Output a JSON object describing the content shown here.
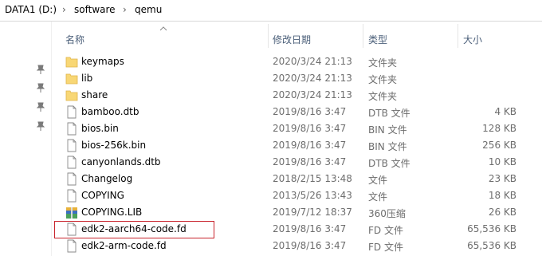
{
  "breadcrumb": [
    "DATA1 (D:)",
    "software",
    "qemu"
  ],
  "breadcrumb_sep": "›",
  "columns": {
    "name": "名称",
    "date": "修改日期",
    "type": "类型",
    "size": "大小"
  },
  "files": [
    {
      "name": "keymaps",
      "date": "2020/3/24 21:13",
      "type": "文件夹",
      "size": "",
      "icon": "folder-icon"
    },
    {
      "name": "lib",
      "date": "2020/3/24 21:13",
      "type": "文件夹",
      "size": "",
      "icon": "folder-icon"
    },
    {
      "name": "share",
      "date": "2020/3/24 21:13",
      "type": "文件夹",
      "size": "",
      "icon": "folder-icon"
    },
    {
      "name": "bamboo.dtb",
      "date": "2019/8/16 3:47",
      "type": "DTB 文件",
      "size": "4 KB",
      "icon": "file-icon"
    },
    {
      "name": "bios.bin",
      "date": "2019/8/16 3:47",
      "type": "BIN 文件",
      "size": "128 KB",
      "icon": "file-icon"
    },
    {
      "name": "bios-256k.bin",
      "date": "2019/8/16 3:47",
      "type": "BIN 文件",
      "size": "256 KB",
      "icon": "file-icon"
    },
    {
      "name": "canyonlands.dtb",
      "date": "2019/8/16 3:47",
      "type": "DTB 文件",
      "size": "10 KB",
      "icon": "file-icon"
    },
    {
      "name": "Changelog",
      "date": "2018/2/15 13:48",
      "type": "文件",
      "size": "23 KB",
      "icon": "file-icon"
    },
    {
      "name": "COPYING",
      "date": "2013/5/26 13:43",
      "type": "文件",
      "size": "18 KB",
      "icon": "file-icon"
    },
    {
      "name": "COPYING.LIB",
      "date": "2019/7/12 18:37",
      "type": "360压缩",
      "size": "26 KB",
      "icon": "archive-icon"
    },
    {
      "name": "edk2-aarch64-code.fd",
      "date": "2019/8/16 3:47",
      "type": "FD 文件",
      "size": "65,536 KB",
      "icon": "file-icon"
    },
    {
      "name": "edk2-arm-code.fd",
      "date": "2019/8/16 3:47",
      "type": "FD 文件",
      "size": "65,536 KB",
      "icon": "file-icon"
    }
  ],
  "highlight_color": "#c8232c"
}
